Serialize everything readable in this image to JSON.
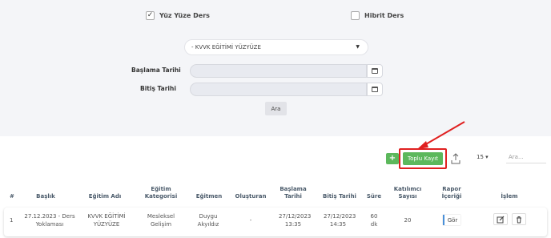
{
  "filters": {
    "option_face_to_face": {
      "label": "Yüz Yüze Ders",
      "checked": true
    },
    "option_hybrid": {
      "label": "Hibrit Ders",
      "checked": false
    },
    "training_select": {
      "value": "- KVVK EĞİTİMİ YÜZYÜZE"
    },
    "start_date_label": "Başlama Tarihi",
    "end_date_label": "Bitiş Tarihi",
    "search_label": "Ara"
  },
  "toolbar": {
    "add_label": "+",
    "bulk_register_label": "Toplu Kayıt",
    "page_size": "15",
    "search_placeholder": "Ara..."
  },
  "table": {
    "columns": [
      "#",
      "Başlık",
      "Eğitim Adı",
      "Eğitim Kategorisi",
      "Eğitmen",
      "Oluşturan",
      "Başlama Tarihi",
      "Bitiş Tarihi",
      "Süre",
      "Katılımcı Sayısı",
      "Rapor İçeriği",
      "İşlem"
    ],
    "rows": [
      {
        "index": "1",
        "title": "27.12.2023 - Ders Yoklaması",
        "training": "KVVK EĞİTİMİ YÜZYÜZE",
        "category": "Mesleksel Gelişim",
        "trainer": "Duygu Akyıldız",
        "creator": "-",
        "start": "27/12/2023 13:35",
        "end": "27/12/2023 14:35",
        "duration": "60 dk",
        "participants": "20",
        "report_label": "Gör"
      }
    ]
  },
  "colors": {
    "accent": "#5cb85c",
    "highlight": "#e02020",
    "panel": "#f4f5f8"
  }
}
